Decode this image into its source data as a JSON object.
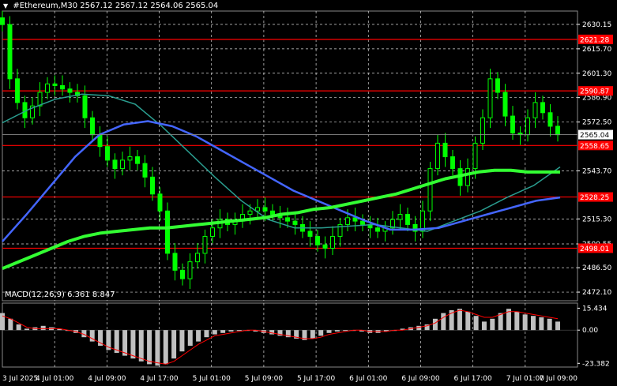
{
  "header": {
    "symbol": "#Ethereum,M30",
    "ohlc": "2567.12 2567.12 2564.06 2565.04"
  },
  "macd_label": "MACD(12,26,9) 6.361 8.847",
  "colors": {
    "background": "#000000",
    "grid": "#ffffff",
    "candles": "#00ff00",
    "level_lines": "#ff0000",
    "ma_slow": "#33ff33",
    "ma_mid": "#4466ff",
    "ma_fast": "#2a9d8f",
    "macd_hist": "#c0c0c0",
    "macd_signal": "#ff0000"
  },
  "chart_data": [
    {
      "type": "candlestick",
      "title": "#Ethereum,M30",
      "y_ticks": [
        "2630.15",
        "2615.70",
        "2601.30",
        "2586.90",
        "2572.50",
        "2543.70",
        "2515.30",
        "2500.55",
        "2486.50",
        "2472.10"
      ],
      "x_ticks": [
        "3 Jul 2025",
        "4 Jul 01:00",
        "4 Jul 09:00",
        "4 Jul 17:00",
        "5 Jul 01:00",
        "5 Jul 09:00",
        "5 Jul 17:00",
        "6 Jul 01:00",
        "6 Jul 09:00",
        "6 Jul 17:00",
        "7 Jul 01:00",
        "7 Jul 09:00"
      ],
      "ylim": [
        2467.0,
        2638.0
      ],
      "grid": true,
      "current_price": "2565.04",
      "levels": [
        "2621.28",
        "2590.87",
        "2558.65",
        "2528.25",
        "2498.01"
      ],
      "close_series": [
        2630,
        2598,
        2584,
        2575,
        2582,
        2590,
        2595,
        2594,
        2592,
        2590,
        2588,
        2575,
        2565,
        2558,
        2550,
        2545,
        2550,
        2552,
        2548,
        2540,
        2530,
        2520,
        2495,
        2485,
        2480,
        2490,
        2495,
        2505,
        2510,
        2515,
        2512,
        2514,
        2518,
        2520,
        2522,
        2520,
        2518,
        2516,
        2514,
        2512,
        2508,
        2505,
        2500,
        2498,
        2505,
        2512,
        2516,
        2514,
        2512,
        2510,
        2508,
        2510,
        2515,
        2518,
        2512,
        2508,
        2520,
        2545,
        2560,
        2552,
        2545,
        2535,
        2545,
        2560,
        2575,
        2598,
        2590,
        2576,
        2566,
        2565,
        2575,
        2584,
        2578,
        2570,
        2565
      ],
      "ma_slow_series": [
        2486,
        2490,
        2494,
        2498,
        2502,
        2505,
        2507,
        2508,
        2509,
        2510,
        2510,
        2511,
        2512,
        2513,
        2514,
        2515,
        2516,
        2518,
        2519,
        2521,
        2522,
        2524,
        2526,
        2528,
        2530,
        2533,
        2536,
        2539,
        2541,
        2543,
        2544,
        2544,
        2543,
        2543,
        2543
      ],
      "ma_mid_series": [
        2502,
        2518,
        2535,
        2552,
        2565,
        2571,
        2573,
        2570,
        2564,
        2556,
        2548,
        2540,
        2532,
        2526,
        2520,
        2514,
        2509,
        2509,
        2510,
        2514,
        2518,
        2522,
        2526,
        2528
      ],
      "ma_fast_series": [
        2572,
        2580,
        2586,
        2589,
        2588,
        2583,
        2570,
        2555,
        2540,
        2526,
        2515,
        2510,
        2510,
        2511,
        2512,
        2510,
        2508,
        2514,
        2520,
        2528,
        2535,
        2546
      ]
    },
    {
      "type": "bar",
      "title": "MACD(12,26,9) 6.361 8.847",
      "y_ticks": [
        "15.434",
        "0.00",
        "-23.382"
      ],
      "ylim": [
        -26.0,
        19.0
      ],
      "histogram": [
        12,
        8,
        4,
        1,
        2,
        3,
        2,
        1,
        0,
        -2,
        -5,
        -8,
        -11,
        -14,
        -16,
        -18,
        -20,
        -22,
        -24,
        -25,
        -24,
        -20,
        -15,
        -11,
        -8,
        -5,
        -3,
        -2,
        -1,
        0,
        0,
        -1,
        -2,
        -3,
        -4,
        -5,
        -6,
        -7,
        -6,
        -4,
        -2,
        -1,
        0,
        0,
        -1,
        -2,
        -2,
        -1,
        0,
        1,
        2,
        3,
        4,
        8,
        12,
        14,
        15,
        13,
        10,
        6,
        8,
        12,
        15,
        13,
        11,
        10,
        9,
        8,
        6
      ],
      "signal": [
        10,
        8,
        5,
        2,
        1,
        1,
        1,
        1,
        0,
        -1,
        -3,
        -6,
        -9,
        -12,
        -14,
        -16,
        -18,
        -20,
        -22,
        -23,
        -24,
        -22,
        -18,
        -14,
        -10,
        -7,
        -4,
        -3,
        -2,
        -1,
        0,
        0,
        -1,
        -2,
        -3,
        -4,
        -5,
        -6,
        -6,
        -5,
        -3,
        -2,
        -1,
        0,
        0,
        -1,
        -1,
        -1,
        0,
        0,
        1,
        2,
        3,
        5,
        9,
        12,
        14,
        13,
        11,
        9,
        9,
        11,
        13,
        13,
        12,
        11,
        10,
        9,
        8
      ]
    }
  ]
}
